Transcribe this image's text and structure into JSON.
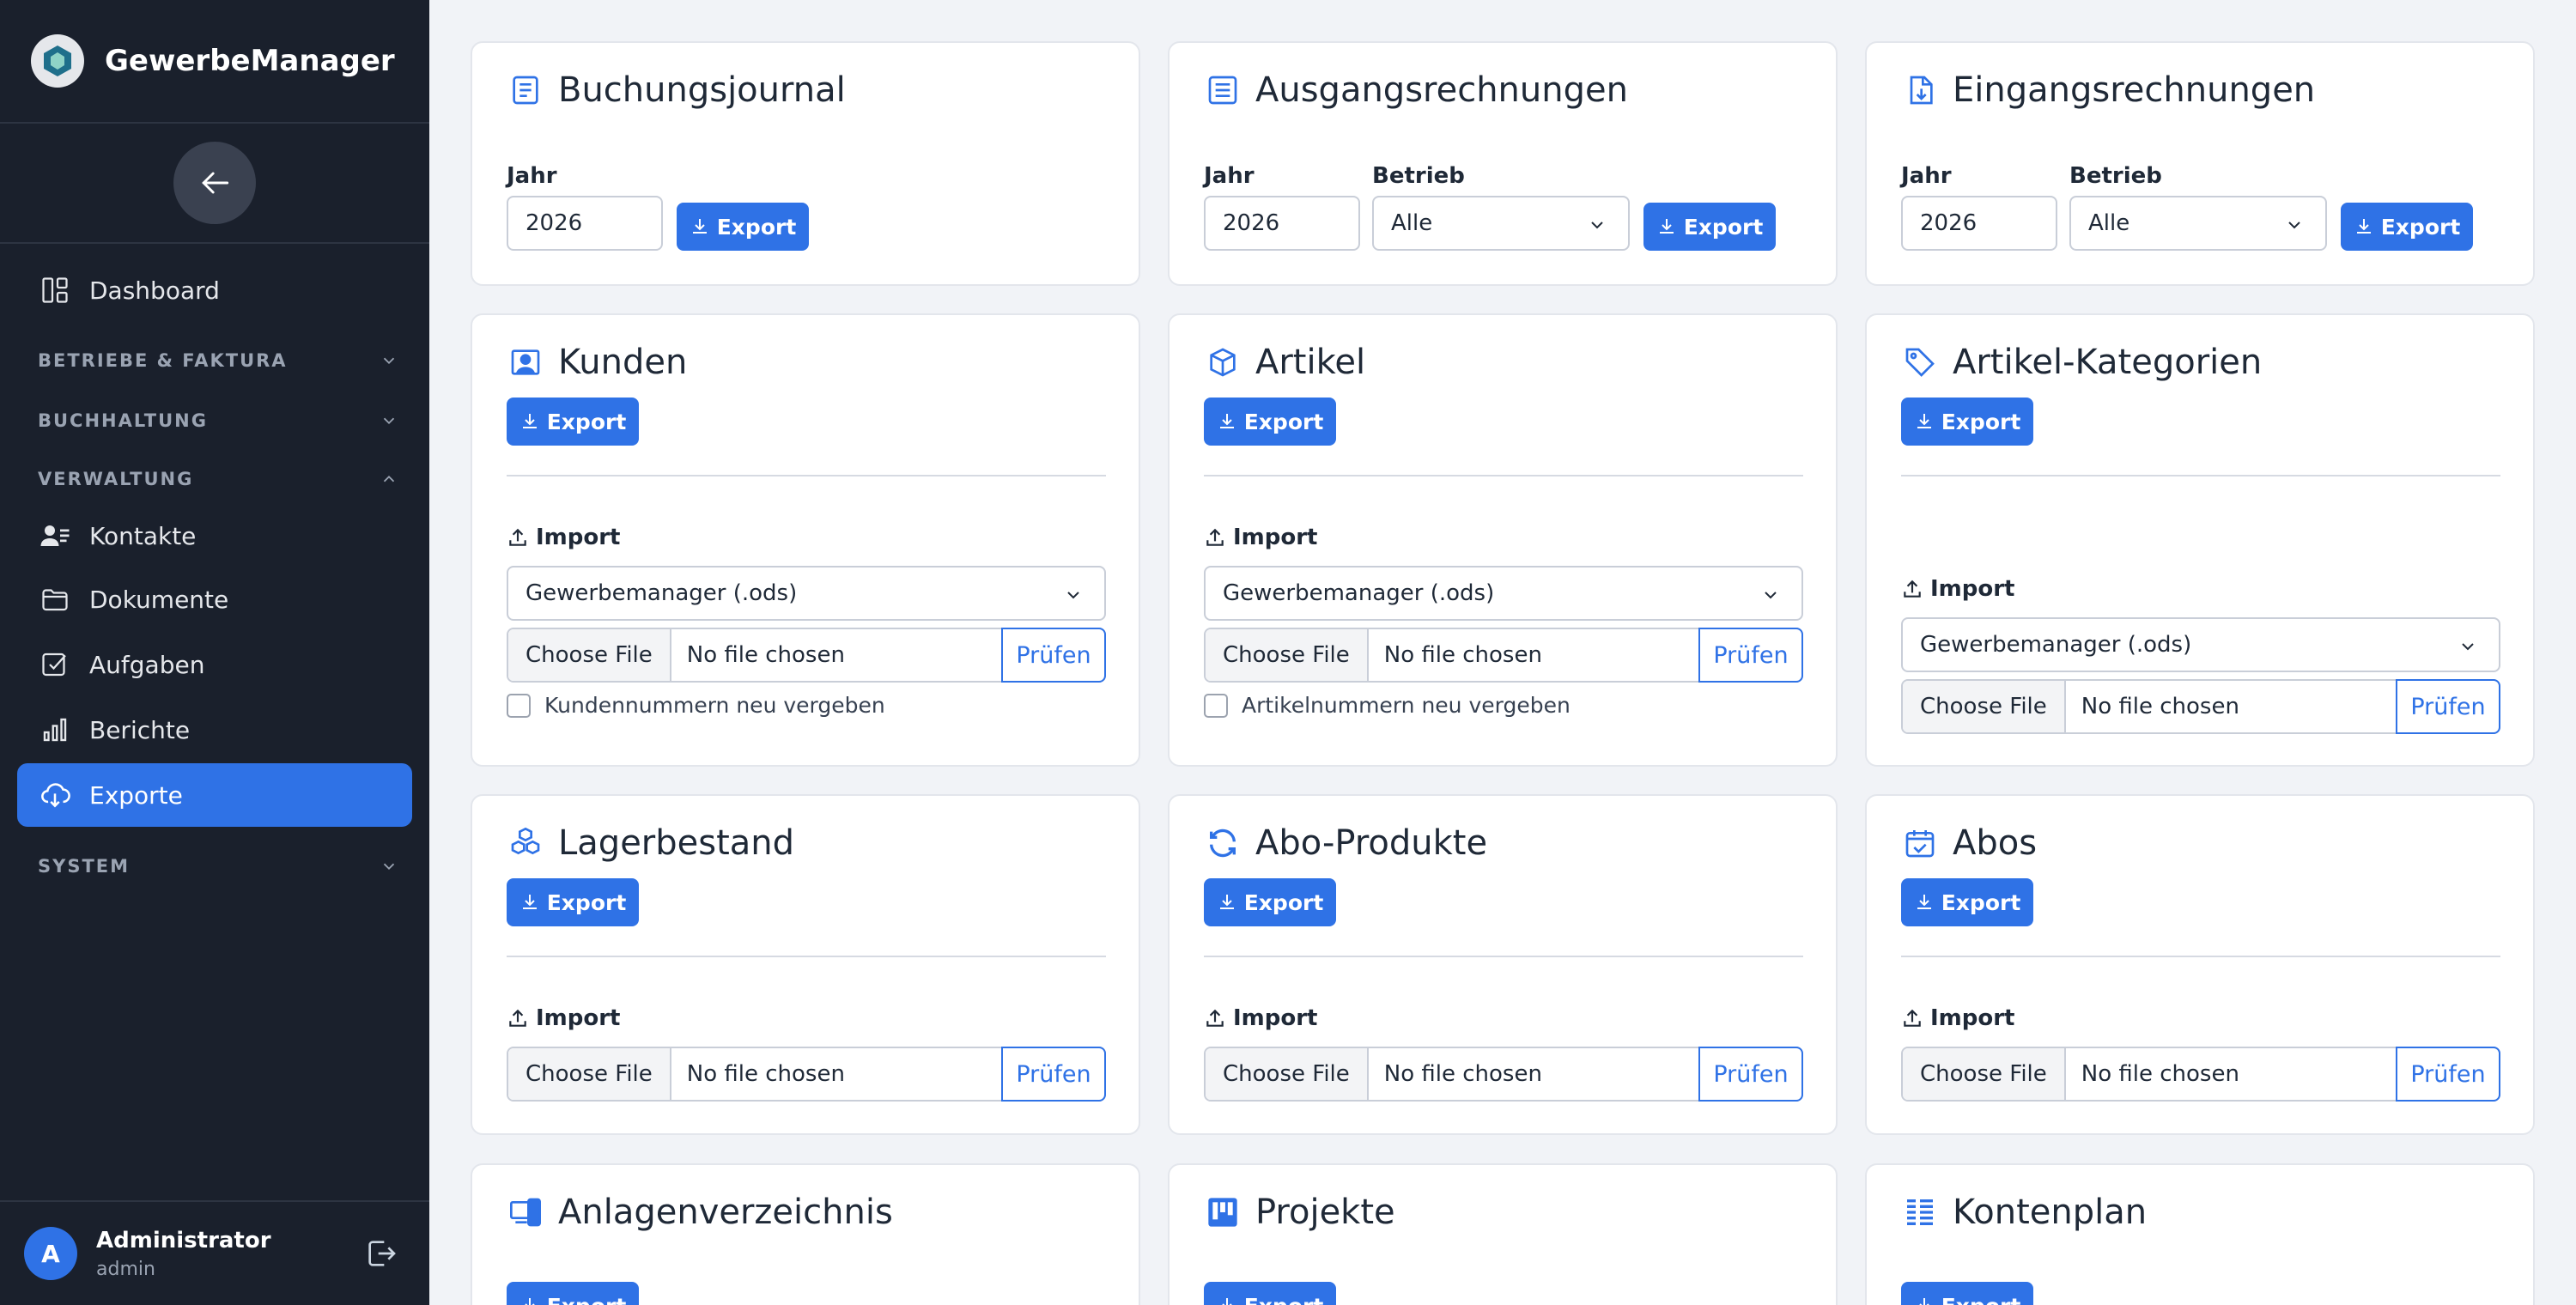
{
  "app": {
    "name": "GewerbeManager"
  },
  "sidebar": {
    "items": [
      {
        "label": "Dashboard"
      },
      {
        "label": "Kontakte"
      },
      {
        "label": "Dokumente"
      },
      {
        "label": "Aufgaben"
      },
      {
        "label": "Berichte"
      },
      {
        "label": "Exporte",
        "active": true
      }
    ],
    "sections": [
      {
        "label": "BETRIEBE & FAKTURA",
        "expanded": false
      },
      {
        "label": "BUCHHALTUNG",
        "expanded": false
      },
      {
        "label": "VERWALTUNG",
        "expanded": true
      },
      {
        "label": "SYSTEM",
        "expanded": false
      }
    ],
    "user": {
      "initial": "A",
      "name": "Administrator",
      "role": "admin"
    }
  },
  "common": {
    "export_label": "Export",
    "import_label": "Import",
    "choose_file": "Choose File",
    "no_file": "No file chosen",
    "pruefen": "Prüfen",
    "year_label": "Jahr",
    "betrieb_label": "Betrieb",
    "year_value": "2026",
    "betrieb_value": "Alle",
    "format_value": "Gewerbemanager (.ods)"
  },
  "cards": {
    "buchungsjournal": {
      "title": "Buchungsjournal"
    },
    "ausgangsrechnungen": {
      "title": "Ausgangsrechnungen"
    },
    "eingangsrechnungen": {
      "title": "Eingangsrechnungen"
    },
    "kunden": {
      "title": "Kunden",
      "checkbox": "Kundennummern neu vergeben"
    },
    "artikel": {
      "title": "Artikel",
      "checkbox": "Artikelnummern neu vergeben"
    },
    "artikel_kategorien": {
      "title": "Artikel-Kategorien"
    },
    "lagerbestand": {
      "title": "Lagerbestand"
    },
    "abo_produkte": {
      "title": "Abo-Produkte"
    },
    "abos": {
      "title": "Abos"
    },
    "anlagenverzeichnis": {
      "title": "Anlagenverzeichnis"
    },
    "projekte": {
      "title": "Projekte"
    },
    "kontenplan": {
      "title": "Kontenplan"
    }
  },
  "colors": {
    "accent": "#2f72e6",
    "sidebar_bg": "#1a202c",
    "page_bg": "#f1f3f7"
  }
}
